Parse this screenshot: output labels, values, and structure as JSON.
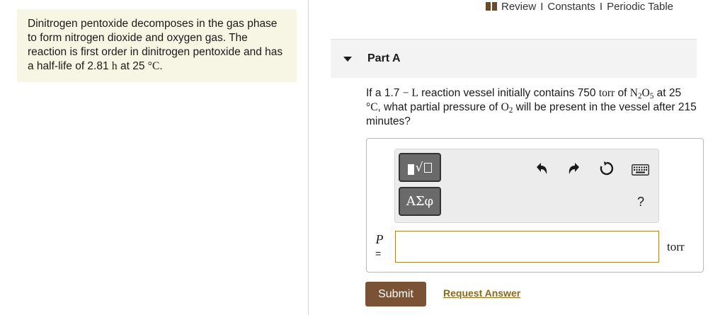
{
  "intro": {
    "text_1": "Dinitrogen pentoxide decomposes in the gas phase to form nitrogen dioxide and oxygen gas. The reaction is first order in dinitrogen pentoxide and has a half-life of 2.81 ",
    "halflife_unit": "h",
    "text_2": " at 25 ",
    "temp_unit": "°C",
    "text_3": "."
  },
  "toplinks": {
    "review": "Review",
    "separator": "I",
    "constants": "Constants",
    "periodic_table": "Periodic Table",
    "icon": "book-icon"
  },
  "part": {
    "title": "Part A"
  },
  "question": {
    "q1": "If a 1.7 ",
    "q_dash": "−",
    "q_L": " L",
    "q2": " reaction vessel initially contains 750 ",
    "q_torr": "torr",
    "q3": " of ",
    "n2o5_N": "N",
    "n2o5_2": "2",
    "n2o5_O": "O",
    "n2o5_5": "5",
    "q4": " at 25 ",
    "q_degC": "°C",
    "q5": ", what partial pressure of ",
    "o2_O": "O",
    "o2_2": "2",
    "q6": " will be present in the vessel after 215 minutes?"
  },
  "toolbar": {
    "greek_label": "ΑΣφ",
    "help_label": "?",
    "template_icon": "templates-icon",
    "undo_icon": "undo-icon",
    "redo_icon": "redo-icon",
    "reset_icon": "reset-icon",
    "keyboard_icon": "keyboard-icon"
  },
  "answer": {
    "variable": "P",
    "equals": "=",
    "value": "",
    "unit": "torr"
  },
  "actions": {
    "submit_label": "Submit",
    "request_label": "Request Answer"
  },
  "colors": {
    "intro_bg": "#f7f5e3",
    "submit_bg": "#7a5236",
    "input_border": "#a8862c",
    "request_link": "#8a6a1a"
  }
}
